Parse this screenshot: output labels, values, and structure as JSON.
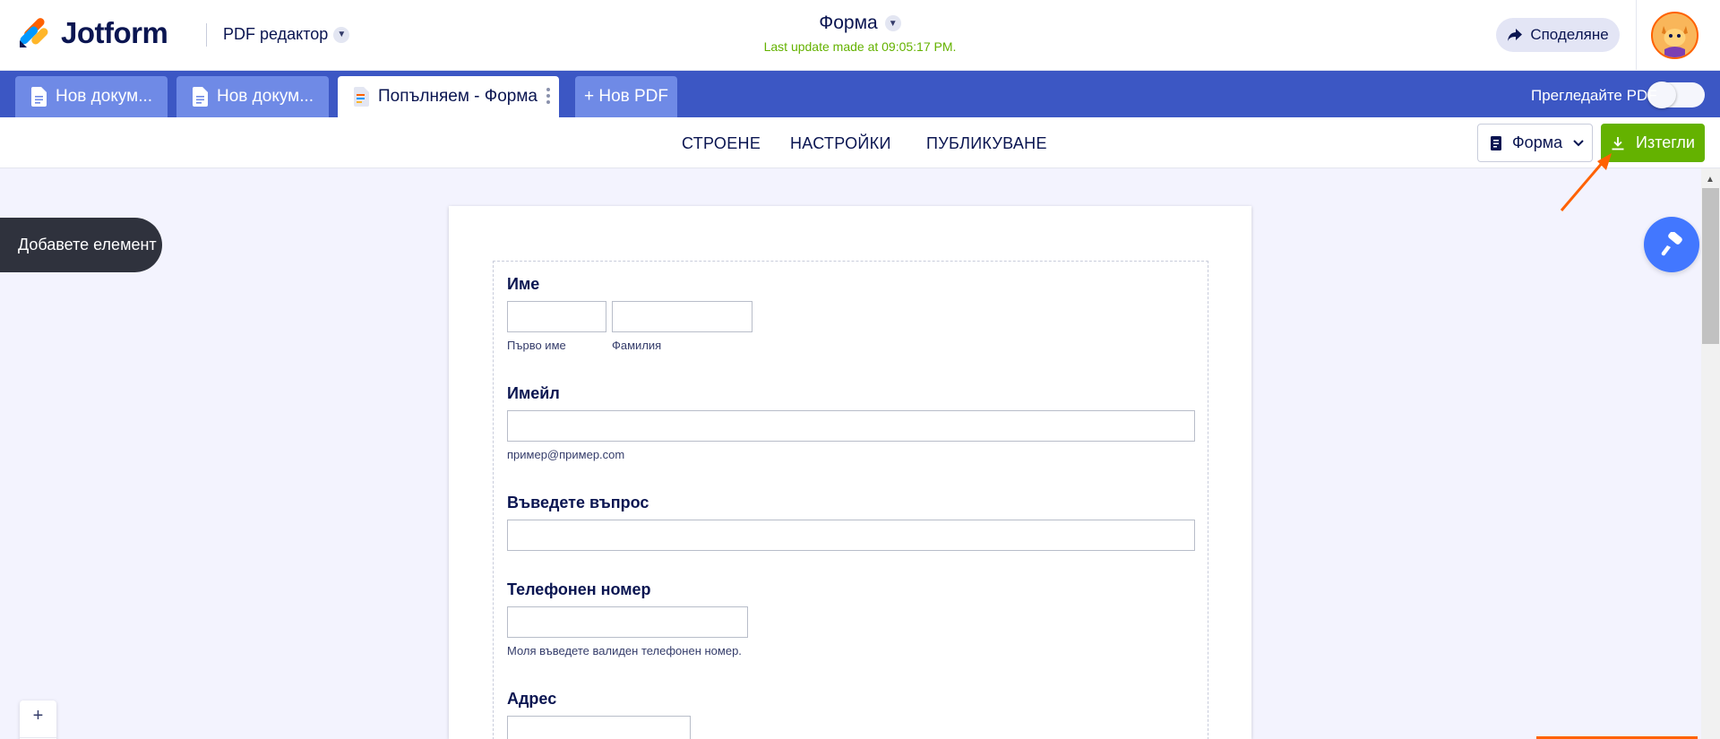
{
  "header": {
    "logo_text": "Jotform",
    "editor_label": "PDF редактор",
    "form_title": "Форма",
    "last_update": "Last update made at 09:05:17 PM.",
    "share_label": "Споделяне"
  },
  "tabs": {
    "items": [
      {
        "label": "Нов докум..."
      },
      {
        "label": "Нов докум..."
      },
      {
        "label": "Попълняем - Форма"
      }
    ],
    "new_pdf_label": "+ Нов PDF",
    "preview_label": "Прегледайте PDF",
    "preview_enabled": false
  },
  "nav": {
    "build": "СТРОЕНЕ",
    "settings": "НАСТРОЙКИ",
    "publish": "ПУБЛИКУВАНЕ",
    "form_select_label": "Форма",
    "download_label": "Изтегли"
  },
  "canvas": {
    "add_element_label": "Добавете елемент",
    "zoom_plus": "+"
  },
  "form": {
    "name_label": "Име",
    "first_name_sub": "Първо име",
    "last_name_sub": "Фамилия",
    "email_label": "Имейл",
    "email_sub": "пример@пример.com",
    "question_label": "Въведете въпрос",
    "phone_label": "Телефонен номер",
    "phone_sub": "Моля въведете валиден телефонен номер.",
    "address_label": "Адрес"
  },
  "colors": {
    "brand_navy": "#0a1551",
    "tabbar_blue": "#3c57c4",
    "tab_inactive": "#6f8ae6",
    "green": "#64b200",
    "orange": "#ff6100",
    "wand_blue": "#4277ff"
  }
}
